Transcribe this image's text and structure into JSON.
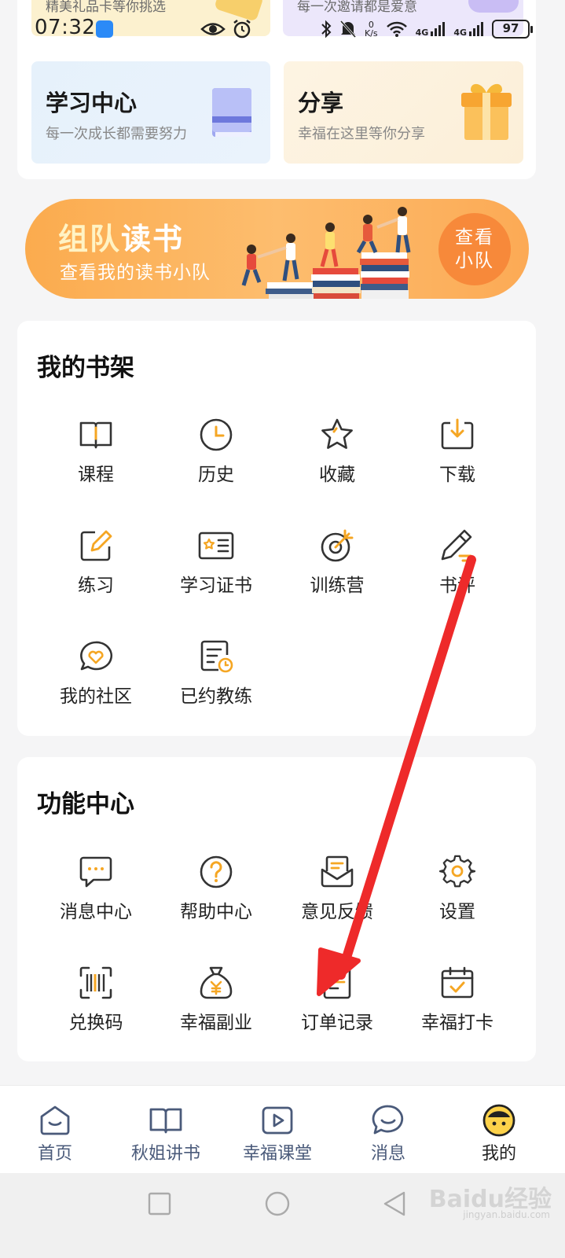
{
  "promo_cards": {
    "gift_text": "精美礼品卡等你挑选",
    "invite_text": "每一次邀请都是爱意"
  },
  "status_bar": {
    "time": "07:32",
    "net_speed_value": "0",
    "net_speed_unit": "K/s",
    "network_1": "4G",
    "network_2": "4G",
    "battery": "97"
  },
  "feature_cards": [
    {
      "title": "学习中心",
      "subtitle": "每一次成长都需要努力",
      "icon": "book-icon"
    },
    {
      "title": "分享",
      "subtitle": "幸福在这里等你分享",
      "icon": "gift-box-icon"
    }
  ],
  "team_banner": {
    "title_highlight": "组队",
    "title_rest": "读书",
    "subtitle": "查看我的读书小队",
    "button_line1": "查看",
    "button_line2": "小队"
  },
  "bookshelf": {
    "title": "我的书架",
    "items": [
      {
        "label": "课程",
        "icon": "open-book-icon"
      },
      {
        "label": "历史",
        "icon": "clock-icon"
      },
      {
        "label": "收藏",
        "icon": "star-icon"
      },
      {
        "label": "下载",
        "icon": "download-icon"
      },
      {
        "label": "练习",
        "icon": "edit-icon"
      },
      {
        "label": "学习证书",
        "icon": "certificate-icon"
      },
      {
        "label": "训练营",
        "icon": "target-icon"
      },
      {
        "label": "书评",
        "icon": "pencil-icon"
      },
      {
        "label": "我的社区",
        "icon": "heart-chat-icon"
      },
      {
        "label": "已约教练",
        "icon": "schedule-doc-icon"
      }
    ]
  },
  "function_center": {
    "title": "功能中心",
    "items": [
      {
        "label": "消息中心",
        "icon": "message-icon"
      },
      {
        "label": "帮助中心",
        "icon": "help-icon"
      },
      {
        "label": "意见反馈",
        "icon": "feedback-mail-icon"
      },
      {
        "label": "设置",
        "icon": "gear-icon"
      },
      {
        "label": "兑换码",
        "icon": "barcode-icon"
      },
      {
        "label": "幸福副业",
        "icon": "money-bag-icon"
      },
      {
        "label": "订单记录",
        "icon": "order-icon"
      },
      {
        "label": "幸福打卡",
        "icon": "calendar-check-icon"
      }
    ]
  },
  "bottom_nav": [
    {
      "label": "首页",
      "icon": "home-smile-icon"
    },
    {
      "label": "秋姐讲书",
      "icon": "book-icon"
    },
    {
      "label": "幸福课堂",
      "icon": "video-play-icon"
    },
    {
      "label": "消息",
      "icon": "chat-icon"
    },
    {
      "label": "我的",
      "icon": "avatar-face-icon",
      "active": true
    }
  ],
  "watermark": {
    "text": "Baidu经验",
    "sub": "jingyan.baidu.com"
  },
  "colors": {
    "accent_orange": "#f5a623",
    "banner_orange": "#fbab4e",
    "annotation_red": "#ee2a2a",
    "icon_dark": "#333333",
    "nav_blue_gray": "#4a5a7a"
  }
}
